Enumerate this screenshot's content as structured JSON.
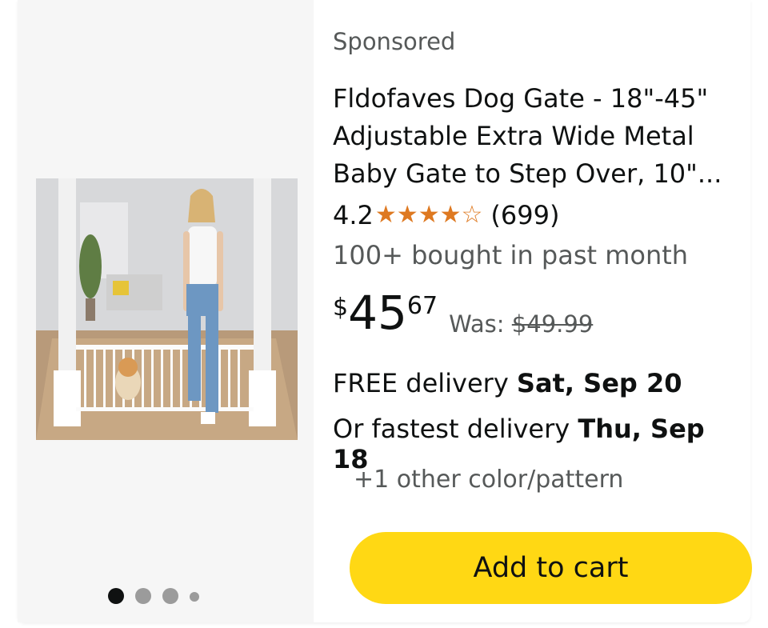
{
  "sponsored_label": "Sponsored",
  "product": {
    "title": "Fldofaves Dog Gate - 18\"-45\" Adjustable Extra Wide Metal Baby Gate to Step Over, 10\"...",
    "rating_value": "4.2",
    "rating_stars": 4.2,
    "review_count": "(699)",
    "bought_text": "100+ bought in past month",
    "price": {
      "symbol": "$",
      "whole": "45",
      "fraction": "67",
      "was_label": "Was: ",
      "was_price": "$49.99"
    },
    "delivery": {
      "free_prefix": "FREE delivery ",
      "free_date": "Sat, Sep 20",
      "fastest_prefix": "Or fastest delivery ",
      "fastest_date": "Thu, Sep 18"
    },
    "other_colors": "+1 other color/pattern",
    "add_to_cart_label": "Add to cart"
  },
  "carousel": {
    "total_dots": 4,
    "active_index": 0
  },
  "icons": {
    "star_full": "star-icon",
    "star_empty": "star-outline-icon"
  },
  "colors": {
    "button_yellow": "#ffd814",
    "star_orange": "#de7921",
    "secondary_text": "#565959"
  }
}
